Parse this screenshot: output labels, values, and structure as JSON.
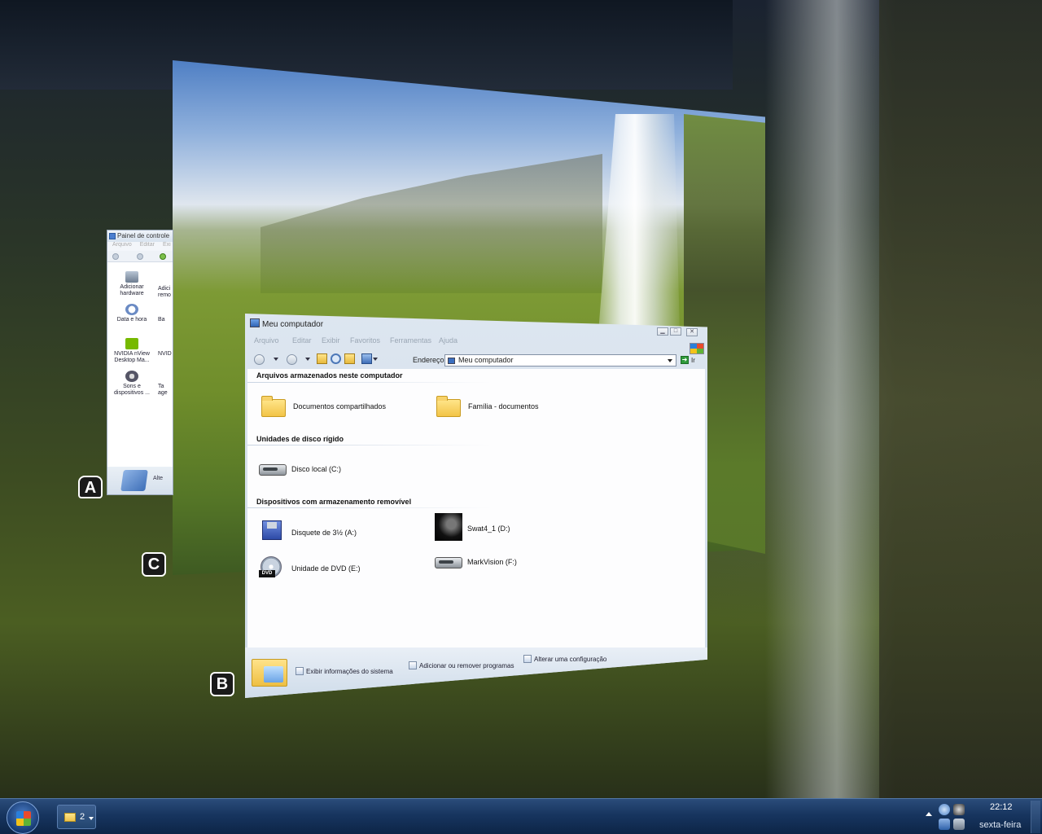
{
  "control_panel": {
    "title": "Painel de controle",
    "menu": [
      "Arquivo",
      "Editar",
      "Exi"
    ],
    "items": [
      {
        "label": "Adicionar hardware",
        "icon": "hardware-icon"
      },
      {
        "label": "Data e hora",
        "icon": "clock-icon"
      },
      {
        "label": "NVIDIA nView Desktop Ma...",
        "icon": "nvidia-icon"
      },
      {
        "label": "Sons e dispositivos ...",
        "icon": "speaker-icon"
      }
    ],
    "items_col2": [
      "Adici",
      "remo",
      "Ba",
      "NVID",
      "Ta",
      "age"
    ],
    "footer_text": "Alte"
  },
  "window": {
    "title": "Meu computador",
    "menu": [
      "Arquivo",
      "Editar",
      "Exibir",
      "Favoritos",
      "Ferramentas",
      "Ajuda"
    ],
    "address_label": "Endereço",
    "address_value": "Meu computador",
    "go_label": "Ir",
    "groups": {
      "files": "Arquivos armazenados neste computador",
      "hard_disks": "Unidades de disco rígido",
      "removable": "Dispositivos com armazenamento removível"
    },
    "items": {
      "shared_docs": "Documentos compartilhados",
      "family_docs": "Família - documentos",
      "local_disk": "Disco local (C:)",
      "floppy": "Disquete de 3½ (A:)",
      "swat": "Swat4_1 (D:)",
      "dvd": "Unidade de DVD (E:)",
      "markvision": "MarkVision (F:)"
    },
    "tasks": {
      "system_info": "Exibir informações do sistema",
      "add_remove": "Adicionar ou remover programas",
      "change_setting": "Alterar uma configuração"
    },
    "dvd_tag": "DVD"
  },
  "markers": {
    "a": "A",
    "c": "C",
    "b": "B"
  },
  "taskbar": {
    "group_count": "2",
    "time": "22:12",
    "day": "sexta-feira"
  },
  "colors": {
    "taskbar": "#17355f",
    "accent": "#2a7fdb"
  }
}
